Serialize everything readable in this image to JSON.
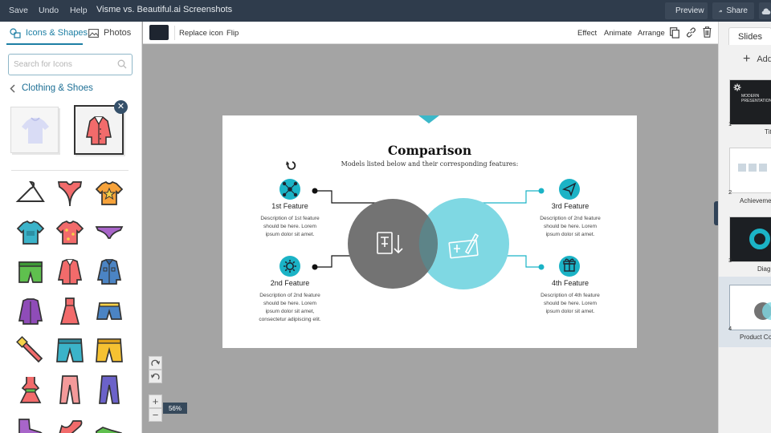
{
  "topbar": {
    "menu": [
      "Save",
      "Undo",
      "Help"
    ],
    "title": "Visme vs. Beautiful.ai Screenshots",
    "preview_label": "Preview",
    "share_label": "Share"
  },
  "left_panel": {
    "tabs": [
      "Icons & Shapes",
      "Photos"
    ],
    "search_placeholder": "Search for Icons",
    "category": "Clothing & Shoes"
  },
  "toolbar": {
    "swatch_color": "#1e2530",
    "left_items": [
      "Replace icon",
      "Flip"
    ],
    "right_items": [
      "Effect",
      "Animate",
      "Arrange"
    ]
  },
  "slide": {
    "title": "Comparison",
    "subtitle": "Models listed below and their corresponding features:",
    "features": [
      {
        "heading": "1st Feature",
        "desc": [
          "Description of 1st feature",
          "should be here. Lorem",
          "ipsum dolor sit amet."
        ]
      },
      {
        "heading": "2nd Feature",
        "desc": [
          "Description of 2nd feature",
          "should be here. Lorem",
          "ipsum dolor sit amet,",
          "consectetur adipiscing elit."
        ]
      },
      {
        "heading": "3rd Feature",
        "desc": [
          "Description of 2nd feature",
          "should be here. Lorem",
          "ipsum dolor sit amet."
        ]
      },
      {
        "heading": "4th Feature",
        "desc": [
          "Description of 4th feature",
          "should be here. Lorem",
          "ipsum dolor sit amet."
        ]
      }
    ],
    "accent_color": "#1bb3c6",
    "gray_color": "#6e6e6e"
  },
  "zoom": {
    "level": "56%"
  },
  "right_panel": {
    "tab": "Slides",
    "add_label": "Add",
    "thumb_text": "MODERN PRESENTATION",
    "thumbs": [
      {
        "num": "1",
        "label": "Tit"
      },
      {
        "num": "2",
        "label": "Achieveme"
      },
      {
        "num": "3",
        "label": "Diag"
      },
      {
        "num": "4",
        "label": "Product Co"
      }
    ]
  }
}
